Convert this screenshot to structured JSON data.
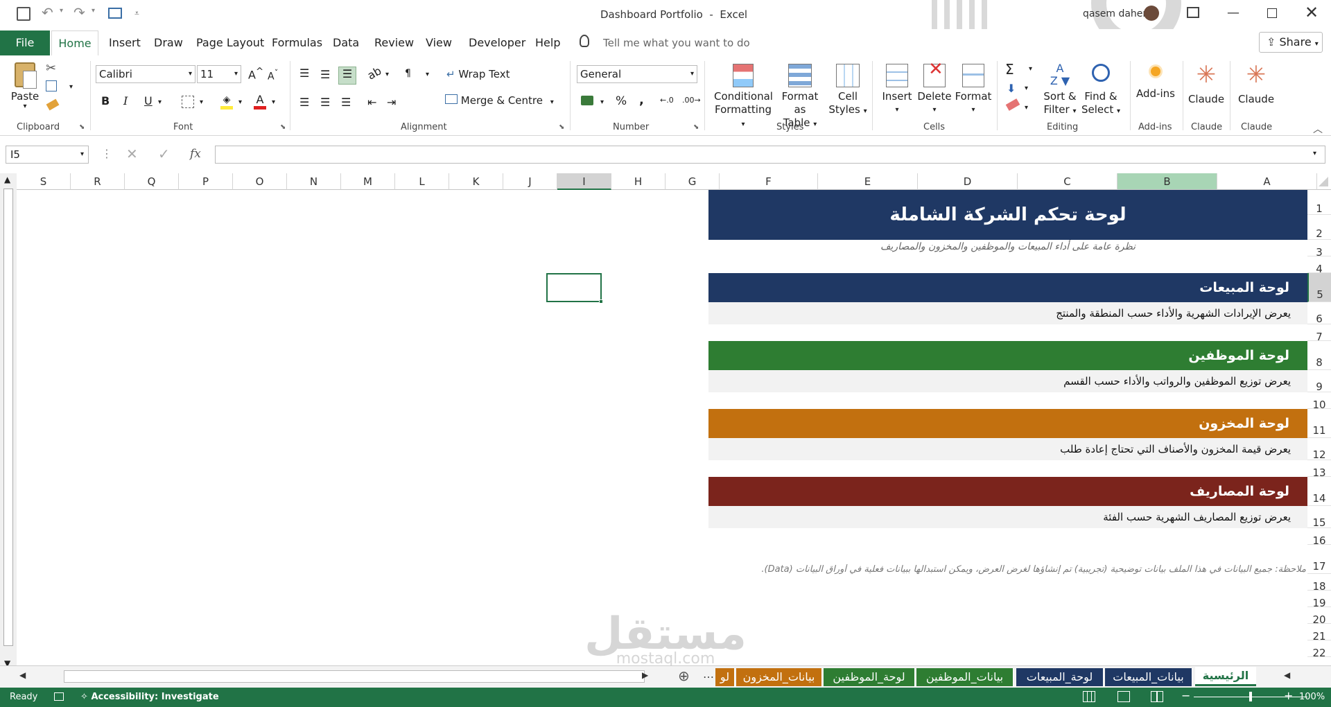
{
  "window": {
    "title": "Dashboard Portfolio",
    "app": "Excel",
    "user": "qasem daher",
    "share_label": "Share"
  },
  "menu": {
    "file": "File",
    "tabs": [
      "Home",
      "Insert",
      "Draw",
      "Page Layout",
      "Formulas",
      "Data",
      "Review",
      "View",
      "Developer",
      "Help"
    ],
    "tell_me": "Tell me what you want to do"
  },
  "ribbon": {
    "clipboard": {
      "paste": "Paste",
      "label": "Clipboard"
    },
    "font": {
      "name": "Calibri",
      "size": "11",
      "label": "Font",
      "bold": "B",
      "italic": "I",
      "underline": "U"
    },
    "alignment": {
      "wrap": "Wrap Text",
      "merge": "Merge & Centre",
      "label": "Alignment"
    },
    "number": {
      "format": "General",
      "label": "Number",
      "percent": "%",
      "comma": ","
    },
    "styles": {
      "conditional": [
        "Conditional",
        "Formatting"
      ],
      "table": [
        "Format as",
        "Table"
      ],
      "cell": [
        "Cell",
        "Styles"
      ],
      "label": "Styles"
    },
    "cells": {
      "insert": "Insert",
      "delete": "Delete",
      "format": "Format",
      "label": "Cells"
    },
    "editing": {
      "sort": [
        "Sort &",
        "Filter"
      ],
      "find": [
        "Find &",
        "Select"
      ],
      "label": "Editing"
    },
    "addins": {
      "btn": "Add-ins",
      "label": "Add-ins"
    },
    "claude1": {
      "btn": "Claude",
      "label": "Claude"
    },
    "claude2": {
      "btn": "Claude",
      "label": "Claude"
    }
  },
  "formula_bar": {
    "name_box": "I5",
    "fx": "fx",
    "value": ""
  },
  "columns": [
    "S",
    "R",
    "Q",
    "P",
    "O",
    "N",
    "M",
    "L",
    "K",
    "J",
    "I",
    "H",
    "G",
    "F",
    "E",
    "D",
    "C",
    "B",
    "A"
  ],
  "rows": [
    "1",
    "2",
    "3",
    "4",
    "5",
    "6",
    "7",
    "8",
    "9",
    "10",
    "11",
    "12",
    "13",
    "14",
    "15",
    "16",
    "17",
    "18",
    "19",
    "20",
    "21",
    "22"
  ],
  "dashboard": {
    "title": "لوحة تحكم الشركة الشاملة",
    "subtitle": "نظرة عامة على أداء المبيعات والموظفين والمخزون والمصاريف",
    "sections": [
      {
        "title": "لوحة المبيعات",
        "desc": "يعرض الإيرادات الشهرية والأداء حسب المنطقة والمنتج",
        "color": "#1f3864"
      },
      {
        "title": "لوحة الموظفين",
        "desc": "يعرض توزيع الموظفين والرواتب والأداء حسب القسم",
        "color": "#2e7d32"
      },
      {
        "title": "لوحة المخزون",
        "desc": "يعرض قيمة المخزون والأصناف التي تحتاج إعادة طلب",
        "color": "#c2700f"
      },
      {
        "title": "لوحة المصاريف",
        "desc": "يعرض توزيع المصاريف الشهرية حسب الفئة",
        "color": "#7b241c"
      }
    ],
    "note": "ملاحظة: جميع البيانات في هذا الملف بيانات توضيحية (تجريبية) تم إنشاؤها لغرض العرض، ويمكن استبدالها ببيانات فعلية في أوراق البيانات (Data)."
  },
  "sheet_tabs": [
    {
      "name": "الرئيسية",
      "color": "#ffffff",
      "text": "#217346"
    },
    {
      "name": "بيانات_المبيعات",
      "color": "#1f3864",
      "text": "#ffffff"
    },
    {
      "name": "لوحة_المبيعات",
      "color": "#1f3864",
      "text": "#ffffff"
    },
    {
      "name": "بيانات_الموظفين",
      "color": "#2e7d32",
      "text": "#ffffff"
    },
    {
      "name": "لوحة_الموظفين",
      "color": "#2e7d32",
      "text": "#ffffff"
    },
    {
      "name": "بيانات_المخزون",
      "color": "#c2700f",
      "text": "#ffffff"
    },
    {
      "name": "لو",
      "color": "#c2700f",
      "text": "#ffffff"
    }
  ],
  "status": {
    "ready": "Ready",
    "accessibility": "Accessibility: Investigate",
    "zoom": "100%"
  },
  "watermark": {
    "ar": "مستقل",
    "en": "mostaql.com"
  }
}
